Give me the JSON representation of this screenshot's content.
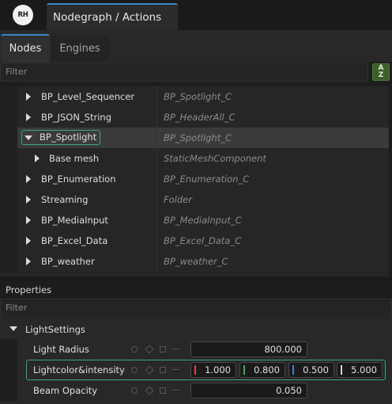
{
  "app": {
    "logo_text": "RH",
    "window_title": "Nodegraph / Actions"
  },
  "panel_tabs": [
    {
      "label": "Nodes",
      "active": true
    },
    {
      "label": "Engines",
      "active": false
    }
  ],
  "node_filter": {
    "placeholder": "Filter",
    "value": ""
  },
  "sort_button": {
    "label": "A\nZ"
  },
  "nodes": [
    {
      "name": "BP_Level_Sequencer",
      "type": "BP_Spotlight_C",
      "expanded": false,
      "selected": false
    },
    {
      "name": "BP_JSON_String",
      "type": "BP_HeaderAll_C",
      "expanded": false,
      "selected": false
    },
    {
      "name": "BP_Spotlight",
      "type": "BP_Spotlight_C",
      "expanded": true,
      "selected": true
    },
    {
      "name": "Base mesh",
      "type": "StaticMeshComponent",
      "expanded": false,
      "selected": false,
      "child": true
    },
    {
      "name": "BP_Enumeration",
      "type": "BP_Enumeration_C",
      "expanded": false,
      "selected": false
    },
    {
      "name": "Streaming",
      "type": "Folder",
      "expanded": false,
      "selected": false
    },
    {
      "name": "BP_MediaInput",
      "type": "BP_MediaInput_C",
      "expanded": false,
      "selected": false
    },
    {
      "name": "BP_Excel_Data",
      "type": "BP_Excel_Data_C",
      "expanded": false,
      "selected": false
    },
    {
      "name": "BP_weather",
      "type": "BP_weather_C",
      "expanded": false,
      "selected": false
    }
  ],
  "properties": {
    "title": "Properties",
    "filter": {
      "placeholder": "Filter",
      "value": ""
    },
    "group_label": "LightSettings",
    "light_radius": {
      "label": "Light Radius",
      "value": "800.000"
    },
    "light_color": {
      "label": "Lightcolor&intensity",
      "channels": [
        {
          "value": "1.000",
          "color": "#d64545"
        },
        {
          "value": "0.800",
          "color": "#3fae4a"
        },
        {
          "value": "0.500",
          "color": "#3d7fd6"
        },
        {
          "value": "5.000",
          "color": "#d0d0d0"
        }
      ]
    },
    "beam_opacity": {
      "label": "Beam Opacity",
      "value": "0.050"
    }
  },
  "colors": {
    "accent_blue": "#3a86c9",
    "selection_teal": "#38a58f",
    "sort_green": "#3c5e2a"
  }
}
